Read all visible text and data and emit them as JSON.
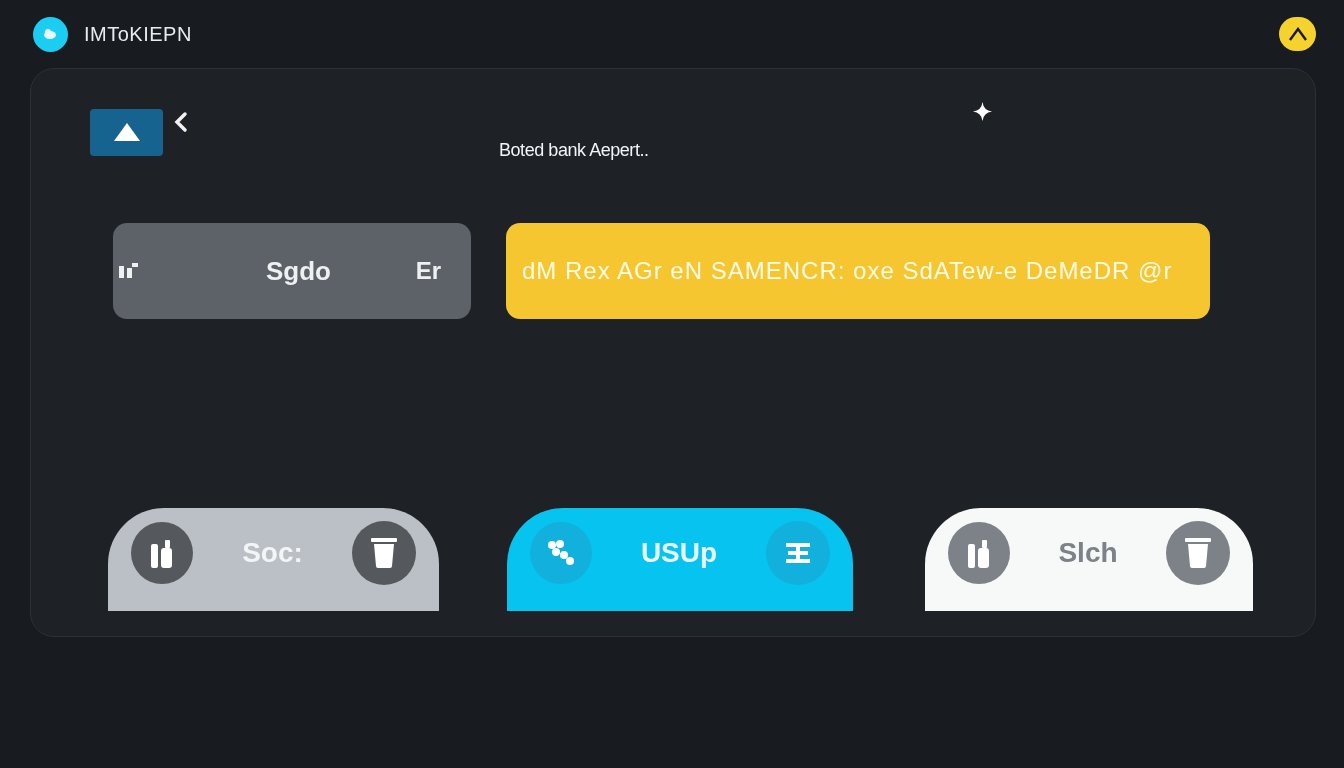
{
  "header": {
    "title": "IMToKIEPN"
  },
  "panel": {
    "subtitle": "Boted bank Aepert..",
    "bars": [
      {
        "kind": "neutral",
        "texts": [
          "Sgdo",
          "Er"
        ]
      },
      {
        "kind": "highlight",
        "texts": [
          "dM Rex AGr eN SAMENCR: oxe SdATew-e DeMeDR @r"
        ]
      }
    ]
  },
  "actions": [
    {
      "kind": "neutral",
      "label": "Soc:"
    },
    {
      "kind": "primary",
      "label": "USUp"
    },
    {
      "kind": "light",
      "label": "Slch"
    }
  ]
}
